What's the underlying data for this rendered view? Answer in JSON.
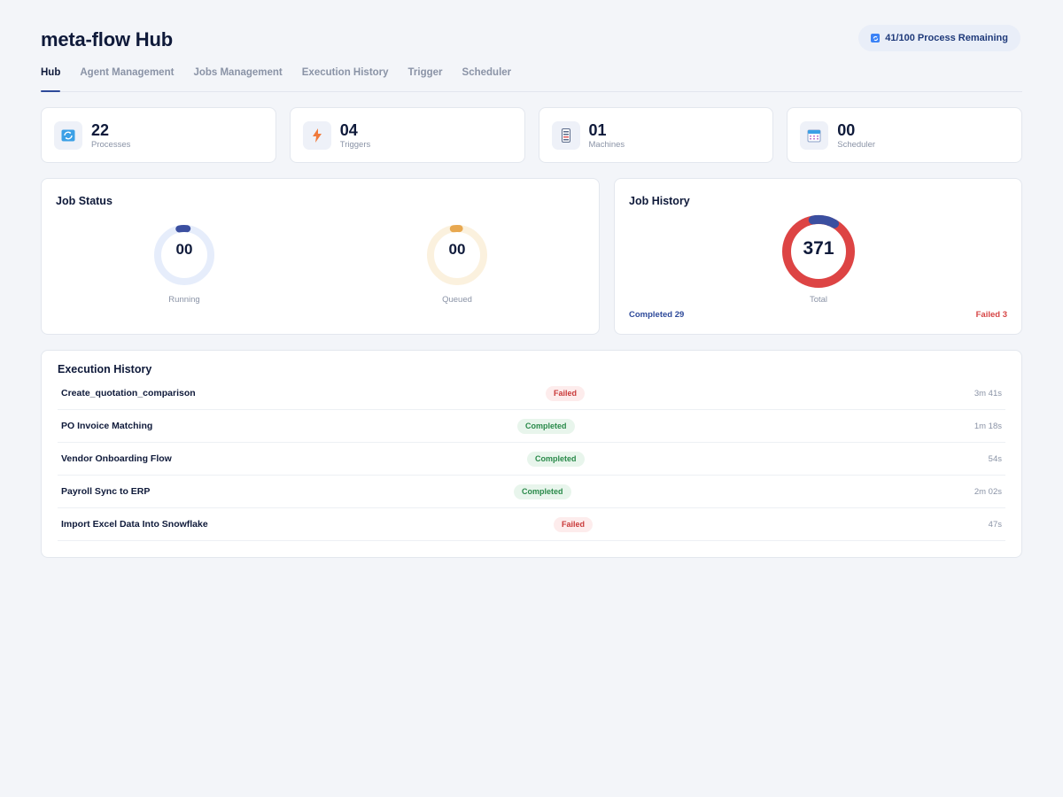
{
  "app": {
    "title": "meta-flow Hub",
    "quota_label": "41/100 Process Remaining"
  },
  "tabs": [
    {
      "label": "Hub",
      "active": true
    },
    {
      "label": "Agent Management",
      "active": false
    },
    {
      "label": "Jobs Management",
      "active": false
    },
    {
      "label": "Execution History",
      "active": false
    },
    {
      "label": "Trigger",
      "active": false
    },
    {
      "label": "Scheduler",
      "active": false
    }
  ],
  "stats": [
    {
      "value": "22",
      "label": "Processes",
      "icon": "refresh-icon"
    },
    {
      "value": "04",
      "label": "Triggers",
      "icon": "lightning-icon"
    },
    {
      "value": "01",
      "label": "Machines",
      "icon": "server-icon"
    },
    {
      "value": "00",
      "label": "Scheduler",
      "icon": "calendar-icon"
    }
  ],
  "job_status": {
    "title": "Job Status",
    "running": {
      "value": "00",
      "label": "Running",
      "color": "#3b4fa0",
      "track": "#e6edfb"
    },
    "queued": {
      "value": "00",
      "label": "Queued",
      "color": "#e8a850",
      "track": "#fbf1de"
    }
  },
  "job_history": {
    "title": "Job History",
    "total": "371",
    "total_label": "Total",
    "completed_label": "Completed 29",
    "failed_label": "Failed 3",
    "completed_color": "#3b4fa0",
    "failed_color": "#dd4444"
  },
  "execution_history": {
    "title": "Execution History",
    "rows": [
      {
        "name": "Create_quotation_comparison",
        "status": "Failed",
        "duration": "3m 41s"
      },
      {
        "name": "PO Invoice Matching",
        "status": "Completed",
        "duration": "1m 18s"
      },
      {
        "name": "Vendor Onboarding Flow",
        "status": "Completed",
        "duration": "54s"
      },
      {
        "name": "Payroll Sync to ERP",
        "status": "Completed",
        "duration": "2m 02s"
      },
      {
        "name": "Import Excel Data Into Snowflake",
        "status": "Failed",
        "duration": "47s"
      }
    ]
  }
}
